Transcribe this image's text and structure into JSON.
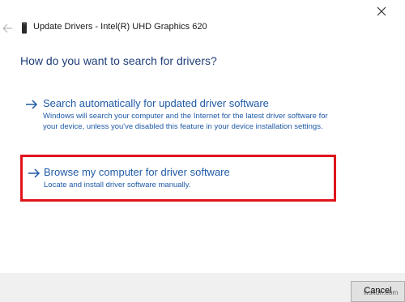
{
  "window": {
    "close_icon": "close-icon",
    "title": "Update Drivers - Intel(R) UHD Graphics 620",
    "back_icon": "back-arrow-icon",
    "device_icon": "display-adapter-icon"
  },
  "main": {
    "heading": "How do you want to search for drivers?",
    "options": [
      {
        "title": "Search automatically for updated driver software",
        "description": "Windows will search your computer and the Internet for the latest driver software for your device, unless you've disabled this feature in your device installation settings.",
        "icon": "arrow-right-icon"
      },
      {
        "title": "Browse my computer for driver software",
        "description": "Locate and install driver software manually.",
        "icon": "arrow-right-icon",
        "highlight_color": "#e0141b"
      }
    ]
  },
  "footer": {
    "cancel_label": "Cancel"
  },
  "watermark": "wsxdn.com",
  "colors": {
    "link_blue": "#1f5aa6",
    "heading_blue": "#203e78",
    "footer_bg": "#f0f0f0"
  }
}
